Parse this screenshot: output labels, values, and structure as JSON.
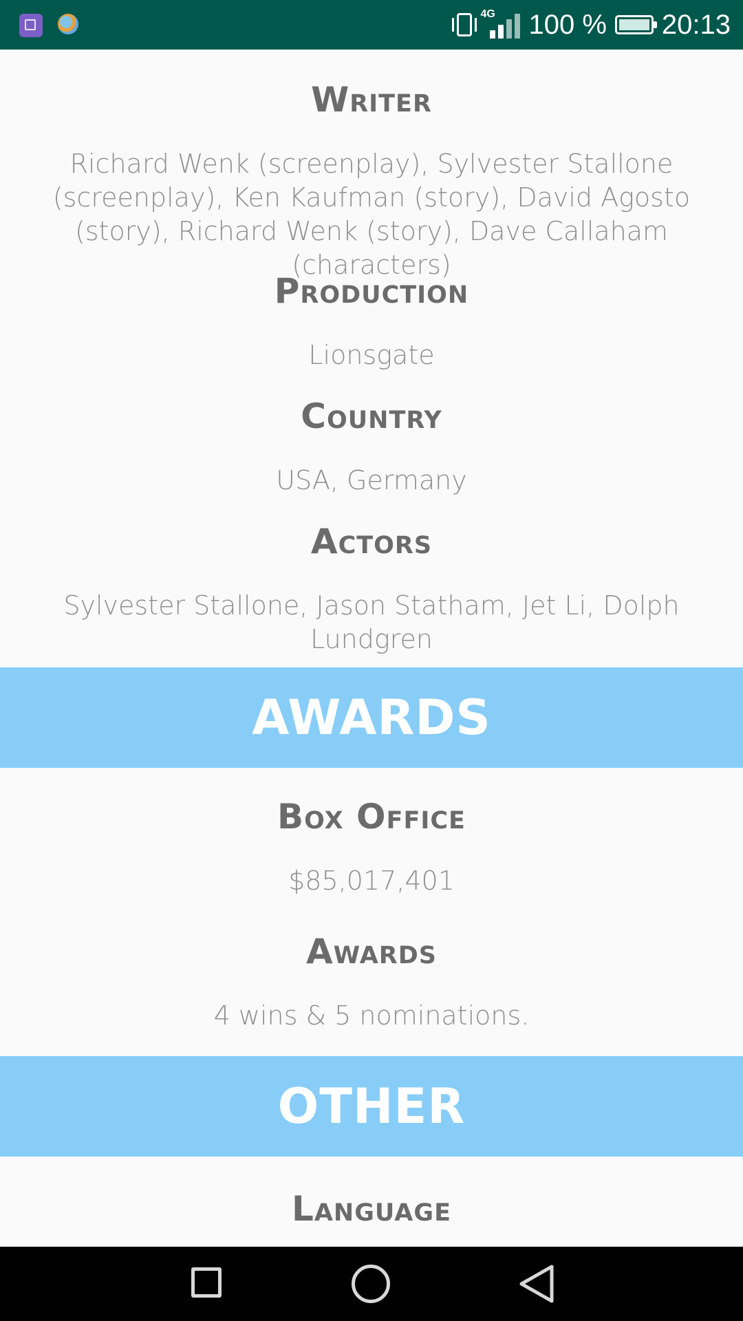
{
  "status_bar": {
    "network": "4G",
    "battery": "100 %",
    "time": "20:13"
  },
  "details": {
    "writer": {
      "label": "Writer",
      "value": "Richard Wenk (screenplay), Sylvester Stallone (screenplay), Ken Kaufman (story), David Agosto (story), Richard Wenk (story), Dave Callaham (characters)"
    },
    "production": {
      "label": "Production",
      "value": "Lionsgate"
    },
    "country": {
      "label": "Country",
      "value": "USA, Germany"
    },
    "actors": {
      "label": "Actors",
      "value": "Sylvester Stallone, Jason Statham, Jet Li, Dolph Lundgren"
    }
  },
  "awards_section": {
    "title": "AWARDS",
    "box_office": {
      "label": "Box Office",
      "value": "$85,017,401"
    },
    "awards": {
      "label": "Awards",
      "value": "4 wins & 5 nominations."
    }
  },
  "other_section": {
    "title": "OTHER",
    "language": {
      "label": "Language"
    }
  },
  "colors": {
    "status_bar": "#00574b",
    "section_banner": "#88cdf8",
    "heading_text": "#6b6b6b",
    "value_text": "#8f8f8f"
  },
  "icons": {
    "status_left": [
      "gallery-icon",
      "globe-icon"
    ],
    "status_right": [
      "vibrate-icon",
      "signal-icon",
      "battery-icon"
    ],
    "nav": [
      "recent-apps-icon",
      "home-icon",
      "back-icon"
    ]
  }
}
